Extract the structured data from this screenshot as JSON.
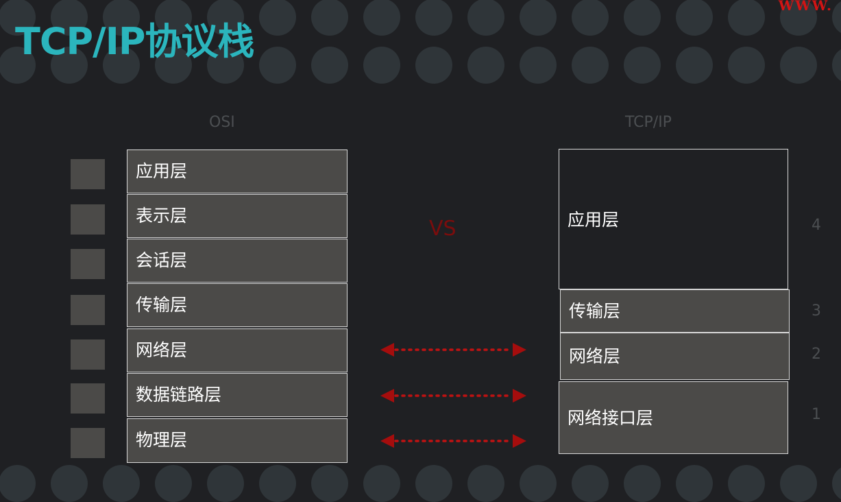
{
  "title": "TCP/IP协议栈",
  "watermark": "WWW.",
  "osi": {
    "header": "OSI",
    "layers": [
      "应用层",
      "表示层",
      "会话层",
      "传输层",
      "网络层",
      "数据链路层",
      "物理层"
    ]
  },
  "tcpip": {
    "header": "TCP/IP",
    "layers": [
      "应用层",
      "传输层",
      "网络层",
      "网络接口层"
    ],
    "numbers": [
      "4",
      "3",
      "2",
      "1"
    ]
  },
  "vs_label": "VS",
  "colors": {
    "title": "#2bb5bd",
    "arrow": "#b30f0f",
    "box_fill": "#4b4a48",
    "border": "#d8d8d8"
  },
  "icons": {
    "arrow": "double-headed-dotted-arrow"
  }
}
